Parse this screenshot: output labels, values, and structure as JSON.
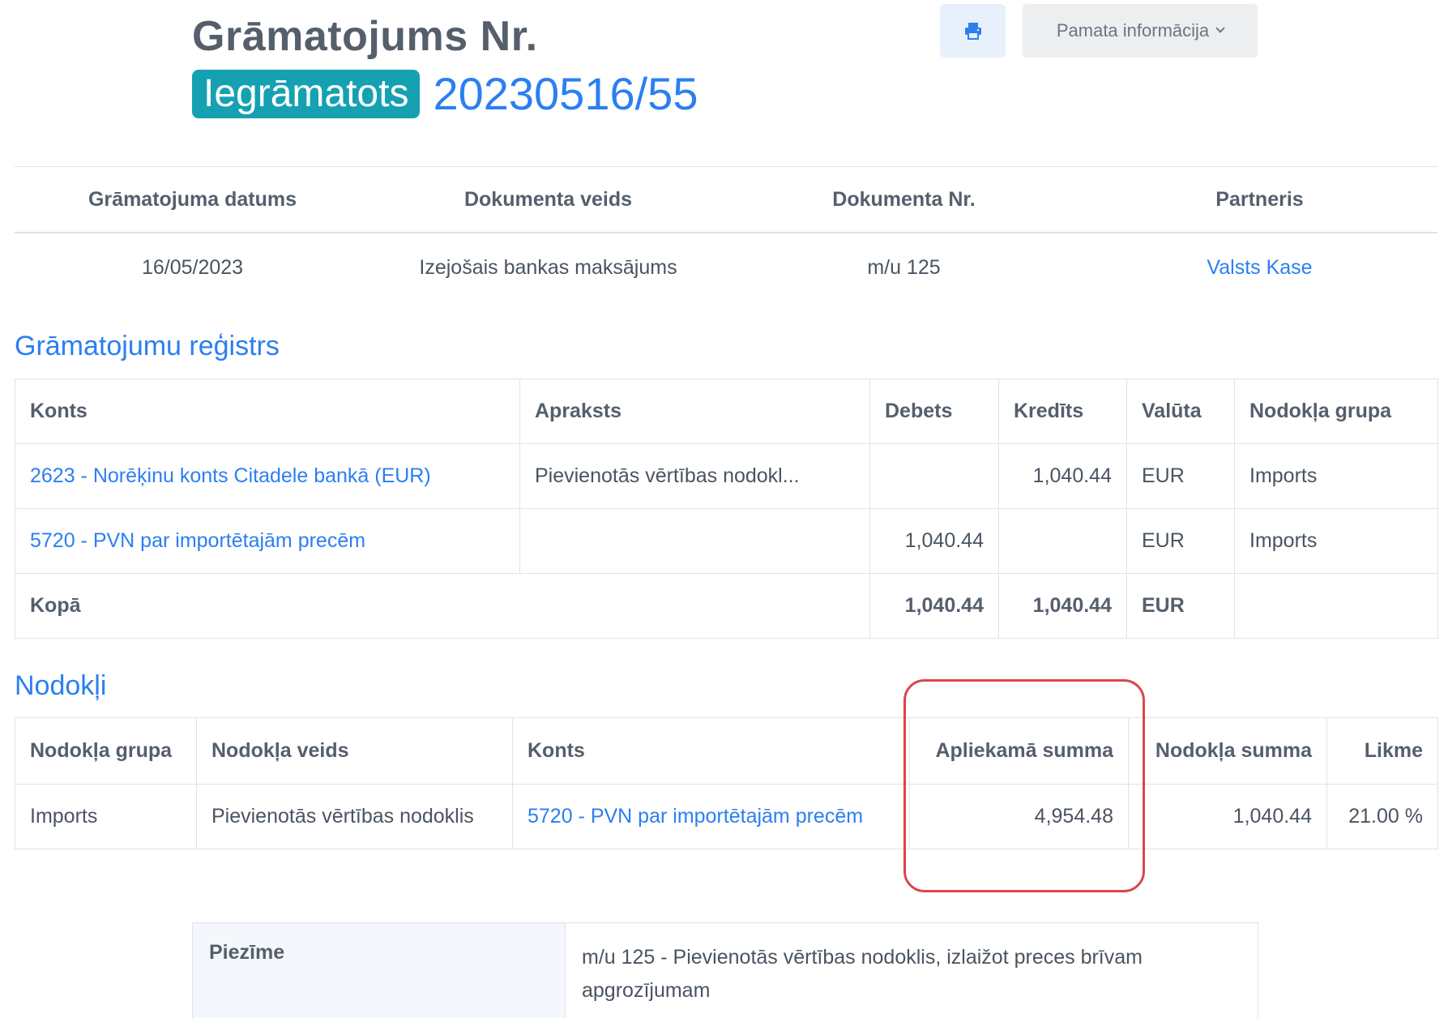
{
  "header": {
    "title": "Grāmatojums Nr.",
    "status": "Iegrāmatots",
    "number": "20230516/55",
    "print_icon": "printer-icon",
    "info_button_label": "Pamata informācija",
    "info_chevron_icon": "chevron-down-icon"
  },
  "summary": {
    "headers": [
      "Grāmatojuma datums",
      "Dokumenta veids",
      "Dokumenta Nr.",
      "Partneris"
    ],
    "values": [
      "16/05/2023",
      "Izejošais bankas maksājums",
      "m/u 125",
      "Valsts Kase"
    ]
  },
  "register": {
    "title": "Grāmatojumu reģistrs",
    "headers": [
      "Konts",
      "Apraksts",
      "Debets",
      "Kredīts",
      "Valūta",
      "Nodokļa grupa"
    ],
    "rows": [
      [
        "2623 - Norēķinu konts Citadele bankā (EUR)",
        "Pievienotās vērtības nodokl...",
        "",
        "1,040.44",
        "EUR",
        "Imports"
      ],
      [
        "5720 - PVN par importētajām precēm",
        "",
        "1,040.44",
        "",
        "EUR",
        "Imports"
      ]
    ],
    "total": [
      "Kopā",
      "1,040.44",
      "1,040.44",
      "EUR",
      ""
    ]
  },
  "taxes": {
    "title": "Nodokļi",
    "headers": [
      "Nodokļa grupa",
      "Nodokļa veids",
      "Konts",
      "Apliekamā summa",
      "Nodokļa summa",
      "Likme"
    ],
    "rows": [
      [
        "Imports",
        "Pievienotās vērtības nodoklis",
        "5720 - PVN par importētajām precēm",
        "4,954.48",
        "1,040.44",
        "21.00 %"
      ]
    ]
  },
  "note": {
    "label": "Piezīme",
    "text": "m/u 125 - Pievienotās vērtības nodoklis, izlaižot preces brīvam apgrozījumam"
  },
  "colors": {
    "accent": "#2b7ff0",
    "badge": "#15a1b1",
    "highlight": "#e0434d"
  }
}
